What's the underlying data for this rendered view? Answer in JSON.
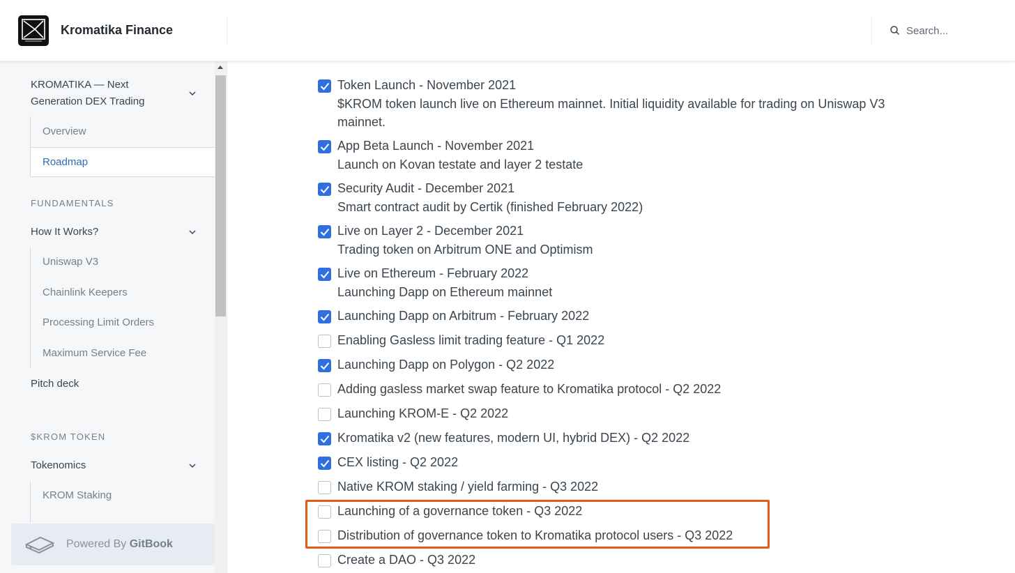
{
  "header": {
    "app_title": "Kromatika Finance",
    "search_placeholder": "Search..."
  },
  "sidebar": {
    "top_group": {
      "label_line1": "KROMATIKA — Next",
      "label_line2": "Generation DEX Trading",
      "items": [
        "Overview",
        "Roadmap"
      ]
    },
    "fundamentals": {
      "section": "FUNDAMENTALS",
      "group_label": "How It Works?",
      "items": [
        "Uniswap V3",
        "Chainlink Keepers",
        "Processing Limit Orders",
        "Maximum Service Fee"
      ],
      "pitch": "Pitch deck"
    },
    "token": {
      "section": "$KROM TOKEN",
      "group_label": "Tokenomics",
      "items": [
        "KROM Staking"
      ]
    },
    "powered_prefix": "Powered By ",
    "powered_brand": "GitBook"
  },
  "roadmap": [
    {
      "checked": true,
      "title": "Token Launch - November 2021",
      "desc": "$KROM token launch live on Ethereum mainnet. Initial liquidity available for trading on Uniswap V3 mainnet."
    },
    {
      "checked": true,
      "title": "App Beta Launch - November 2021",
      "desc": "Launch on Kovan testate and layer 2 testate"
    },
    {
      "checked": true,
      "title": "Security Audit - December 2021",
      "desc": "Smart contract audit by Certik (finished February 2022)"
    },
    {
      "checked": true,
      "title": "Live on Layer 2 - December 2021",
      "desc": "Trading token on Arbitrum ONE and Optimism"
    },
    {
      "checked": true,
      "title": "Live on Ethereum - February 2022",
      "desc": "Launching Dapp on Ethereum mainnet"
    },
    {
      "checked": true,
      "title": "Launching Dapp on Arbitrum - February 2022"
    },
    {
      "checked": false,
      "title": "Enabling Gasless limit trading feature - Q1 2022"
    },
    {
      "checked": true,
      "title": "Launching Dapp on Polygon - Q2 2022"
    },
    {
      "checked": false,
      "title": "Adding gasless market swap feature to Kromatika protocol - Q2 2022"
    },
    {
      "checked": false,
      "title": "Launching KROM-E - Q2 2022"
    },
    {
      "checked": true,
      "title": "Kromatika v2 (new features, modern UI, hybrid DEX) - Q2 2022"
    },
    {
      "checked": true,
      "title": "CEX listing - Q2 2022"
    },
    {
      "checked": false,
      "title": "Native KROM staking / yield farming - Q3 2022"
    },
    {
      "checked": false,
      "title": "Launching of a governance token - Q3 2022"
    },
    {
      "checked": false,
      "title": "Distribution of governance token to Kromatika protocol users - Q3 2022"
    },
    {
      "checked": false,
      "title": "Create a DAO - Q3 2022"
    }
  ],
  "colors": {
    "accent": "#2f6fe0",
    "highlight": "#e85a1b",
    "sidebar_bg": "#f5f7f9"
  }
}
